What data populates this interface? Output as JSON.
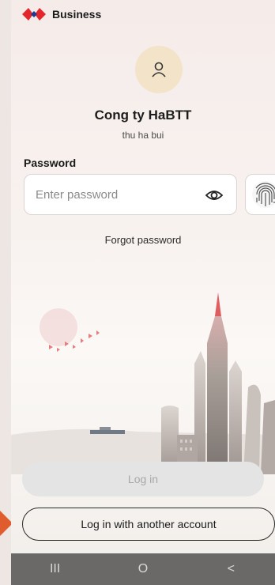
{
  "header": {
    "brand": "Business"
  },
  "account": {
    "company": "Cong ty HaBTT",
    "username": "thu ha bui"
  },
  "password": {
    "label": "Password",
    "placeholder": "Enter password"
  },
  "links": {
    "forgot": "Forgot password"
  },
  "buttons": {
    "login": "Log in",
    "alternate": "Log in with another account"
  },
  "navbar": {
    "recents": "III",
    "home": "O",
    "back": "<"
  },
  "colors": {
    "brand_red": "#e3262c",
    "avatar_bg": "#f3e3c8",
    "navbar": "#6b6868",
    "disabled_button": "#e4e4e4",
    "arrow": "#e05c2c"
  }
}
